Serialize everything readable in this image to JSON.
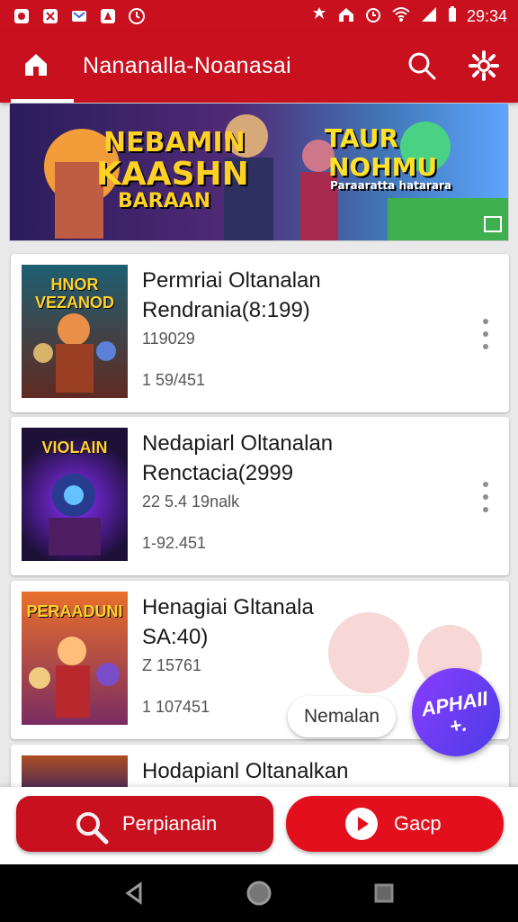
{
  "status_bar": {
    "time": "29:34",
    "icons": [
      "notification-icon",
      "notification-icon",
      "mail-icon",
      "security-icon",
      "clock-icon",
      "alarm-icon",
      "home-alert-icon",
      "timer-icon",
      "wifi-icon",
      "signal-icon",
      "battery-icon"
    ]
  },
  "header": {
    "title": "Nananalla-Noanasai",
    "home_icon": "home-icon",
    "search_icon": "search-icon",
    "settings_icon": "settings-icon"
  },
  "banner": {
    "left_title": "NEBAMIN",
    "left_subtitle": "KAASHN",
    "left_tag": "BARAAN",
    "right_title": "TAUR",
    "right_subtitle": "NOHMU",
    "right_tag": "Paraaratta hatarara"
  },
  "games": [
    {
      "thumbnail_label": "HNOR VEZANOD",
      "title_line1": "Permriai Oltanalan",
      "title_line2": "Rendrania(8:199)",
      "meta1": "119029",
      "meta2": "1 59/451"
    },
    {
      "thumbnail_label": "VIOLAIN",
      "title_line1": "Nedapiarl Oltanalan",
      "title_line2": "Renctacia(2999",
      "meta1": "22 5.4 19nalk",
      "meta2": "1-92.451"
    },
    {
      "thumbnail_label": "PERAADUNI",
      "title_line1": "Henagiai Gltanala",
      "title_line2": "SA:40)",
      "meta1": "Z 15761",
      "meta2": "1 107451"
    },
    {
      "title_line1": "Hodapianl Oltanalkan"
    }
  ],
  "fab": {
    "chip_label": "Nemalan",
    "label": "APHAII +."
  },
  "bottom_actions": {
    "search_label": "Perpianain",
    "go_label": "Gacp"
  },
  "navigation": {
    "back_icon": "back-icon",
    "home_icon": "home-circle-icon",
    "recents_icon": "recents-icon"
  }
}
